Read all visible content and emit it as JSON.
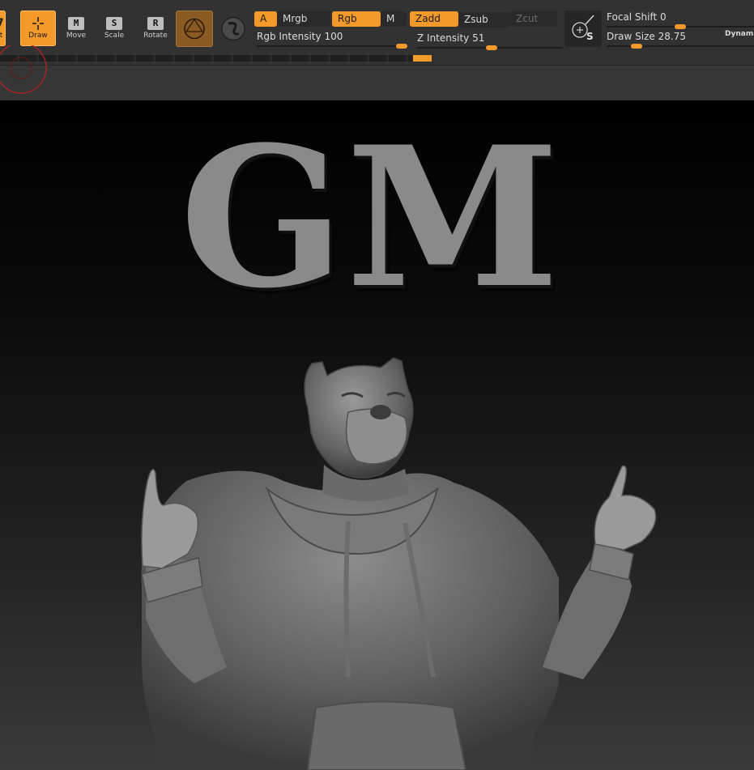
{
  "toolbar": {
    "partial_tool_glyph": "7",
    "partial_tool_label": "t",
    "tools": [
      {
        "glyph": "draw-crosshair-icon",
        "label": "Draw",
        "active": true
      },
      {
        "glyph": "M",
        "label": "Move",
        "active": false
      },
      {
        "glyph": "S",
        "label": "Scale",
        "active": false
      },
      {
        "glyph": "R",
        "label": "Rotate",
        "active": false
      }
    ],
    "material_icon": "material-sphere-icon",
    "stroke_icon": "stroke-swirl-icon",
    "modes_row1": [
      {
        "label": "A",
        "state": "on"
      },
      {
        "label": "Mrgb",
        "state": "normal"
      },
      {
        "label": "Rgb",
        "state": "on"
      },
      {
        "label": "M",
        "state": "normal"
      }
    ],
    "modes_row2": [
      {
        "label": "Zadd",
        "state": "on"
      },
      {
        "label": "Zsub",
        "state": "normal"
      },
      {
        "label": "Zcut",
        "state": "off"
      }
    ],
    "rgb_intensity": {
      "label": "Rgb Intensity",
      "value": "100",
      "fraction": 1.0
    },
    "z_intensity": {
      "label": "Z Intensity",
      "value": "51",
      "fraction": 0.51
    },
    "lightbox_icon": "spotlight-s-icon",
    "focal_shift": {
      "label": "Focal Shift",
      "value": "0",
      "fraction": 0.5
    },
    "draw_size": {
      "label": "Draw Size",
      "value": "28.75",
      "fraction": 0.18
    },
    "dynamic_label": "Dynamic"
  },
  "viewport": {
    "title_text": "GM",
    "model_description_icon": "dog-hoodie-sculpt"
  },
  "colors": {
    "accent": "#f39a2b",
    "panel": "#323232",
    "title_gray": "#8a8a8a"
  }
}
